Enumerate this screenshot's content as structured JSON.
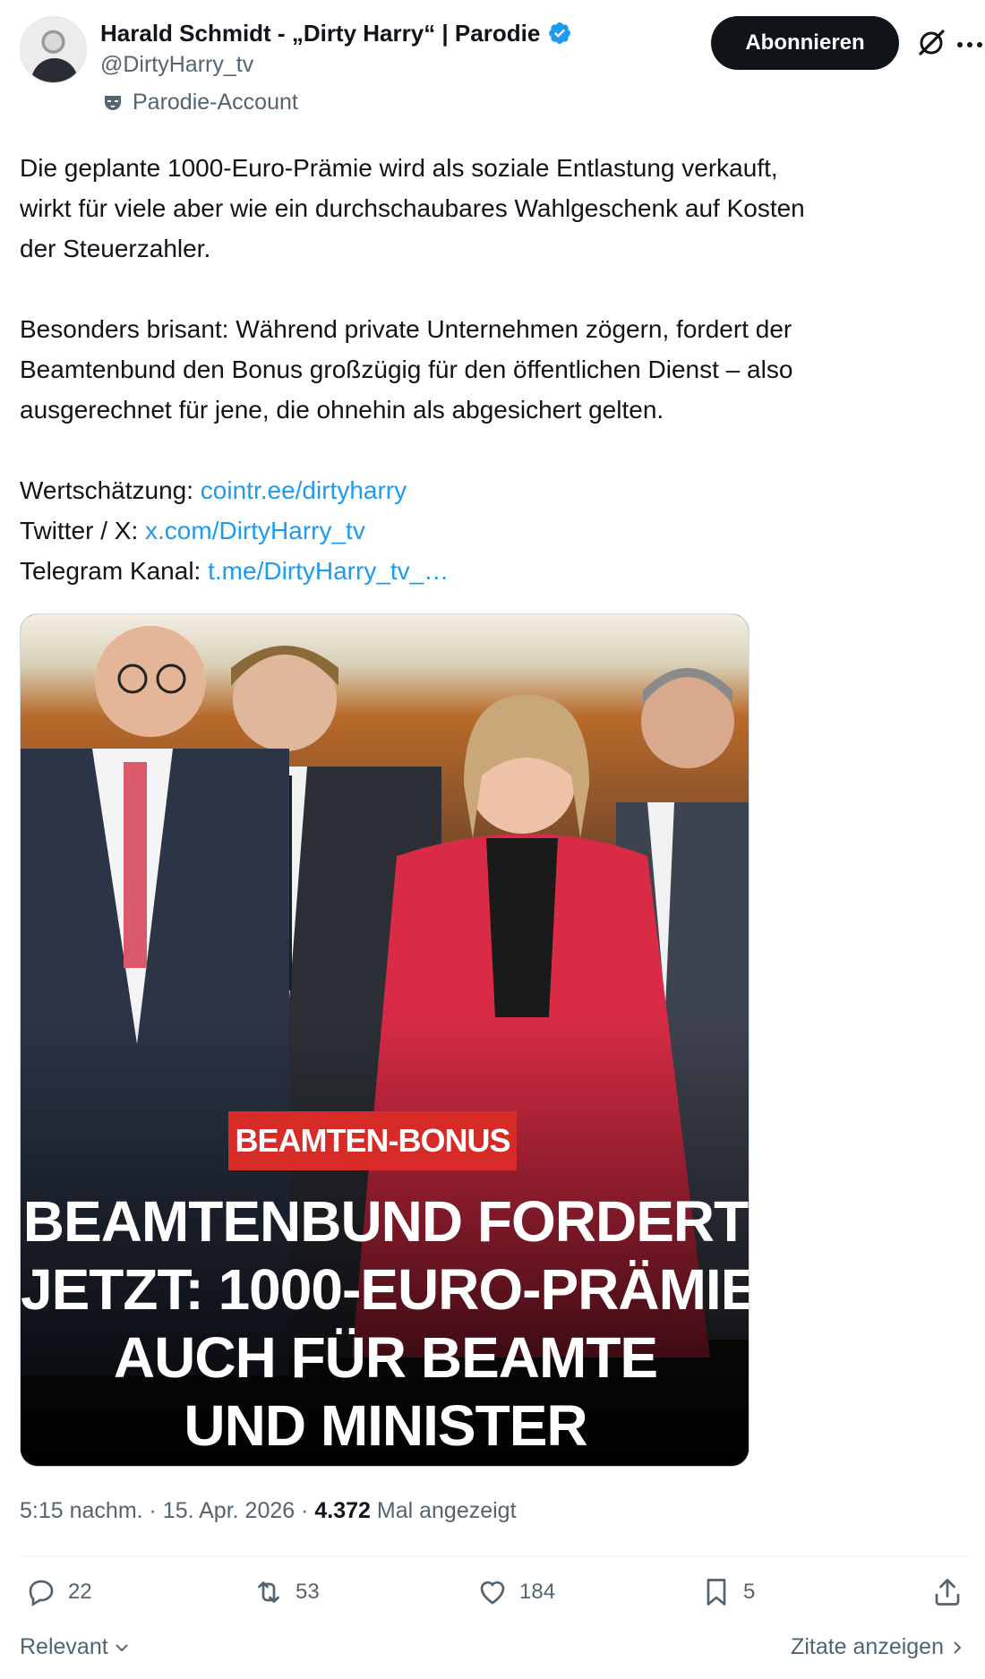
{
  "author": {
    "name": "Harald Schmidt - „Dirty Harry“ | Parodie",
    "handle": "@DirtyHarry_tv",
    "label": "Parodie-Account"
  },
  "header": {
    "subscribe_label": "Abonnieren"
  },
  "tweet": {
    "lines_p1": [
      "Die  geplante 1000-Euro-Prämie wird als soziale Entlastung verkauft,",
      "wirkt für viele aber wie ein durchschaubares Wahlgeschenk auf Kosten",
      "der  Steuerzahler."
    ],
    "lines_p2": [
      "Besonders brisant: Während private Unternehmen zögern,  fordert der",
      "Beamtenbund den Bonus großzügig für den öffentlichen Dienst –  also",
      "ausgerechnet für jene, die ohnehin als abgesichert gelten."
    ],
    "links": [
      {
        "label": "Wertschätzung: ",
        "url": "cointr.ee/dirtyharry"
      },
      {
        "label": "Twitter / X: ",
        "url": "x.com/DirtyHarry_tv"
      },
      {
        "label": "Telegram Kanal: ",
        "url": "t.me/DirtyHarry_tv_…"
      }
    ]
  },
  "media": {
    "badge": "BEAMTEN-BONUS",
    "headline": [
      "BEAMTENBUND FORDERT",
      "JETZT: 1000-EURO-PRÄMIE",
      "AUCH FÜR BEAMTE",
      "UND MINISTER"
    ]
  },
  "meta": {
    "time": "5:15 nachm. · 15. Apr. 2026 · ",
    "views": "4.372",
    "views_label": " Mal angezeigt"
  },
  "actions": {
    "replies": "22",
    "reposts": "53",
    "likes": "184",
    "bookmarks": "5"
  },
  "footer": {
    "sort_label": "Relevant",
    "quotes_label": "Zitate anzeigen"
  },
  "colors": {
    "accent": "#1d9bf0",
    "badge": "#d62b26",
    "button": "#0f1419",
    "muted": "#536471"
  }
}
